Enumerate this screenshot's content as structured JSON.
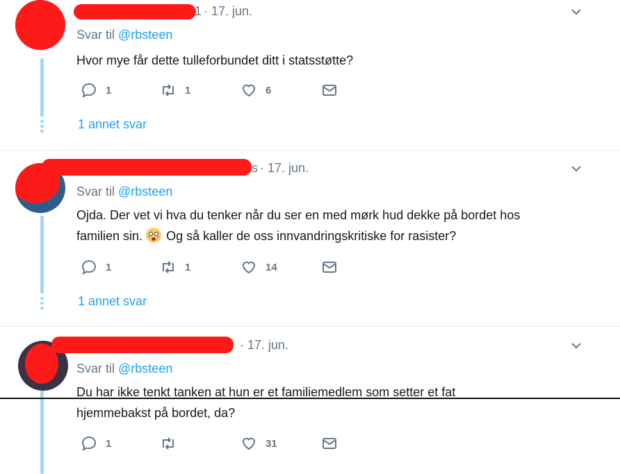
{
  "tweets": [
    {
      "name_suffix": "1",
      "date": "· 17. jun.",
      "reply_prefix": "Svar til",
      "reply_handle": "@rbsteen",
      "text_line1": "Hvor mye får dette tulleforbundet ditt i statsstøtte?",
      "replies": "1",
      "retweets": "1",
      "likes": "6",
      "more_replies": "1 annet svar"
    },
    {
      "name_suffix": "s",
      "date": "· 17. jun.",
      "reply_prefix": "Svar til",
      "reply_handle": "@rbsteen",
      "text_line1": "Ojda. Der vet vi hva du tenker når du ser en med mørk hud dekke på bordet hos",
      "text_line2_a": "familien sin.",
      "text_line2_b": "Og så kaller de oss innvandringskritiske for rasister?",
      "replies": "1",
      "retweets": "1",
      "likes": "14",
      "more_replies": "1 annet svar"
    },
    {
      "name_suffix": "",
      "date": "· 17. jun.",
      "reply_prefix": "Svar til",
      "reply_handle": "@rbsteen",
      "text_line1": "Du har ikke tenkt tanken at hun er et familiemedlem som setter et fat",
      "text_line2": "hjemmebakst på bordet, da?",
      "replies": "1",
      "retweets": "",
      "likes": "31"
    }
  ],
  "colors": {
    "accent": "#1da1f2",
    "muted": "#657786",
    "redaction": "#ff1a1a",
    "thread": "#9fd8f2"
  },
  "icons": [
    "reply-icon",
    "retweet-icon",
    "like-icon",
    "message-icon",
    "chevron-down-icon"
  ]
}
